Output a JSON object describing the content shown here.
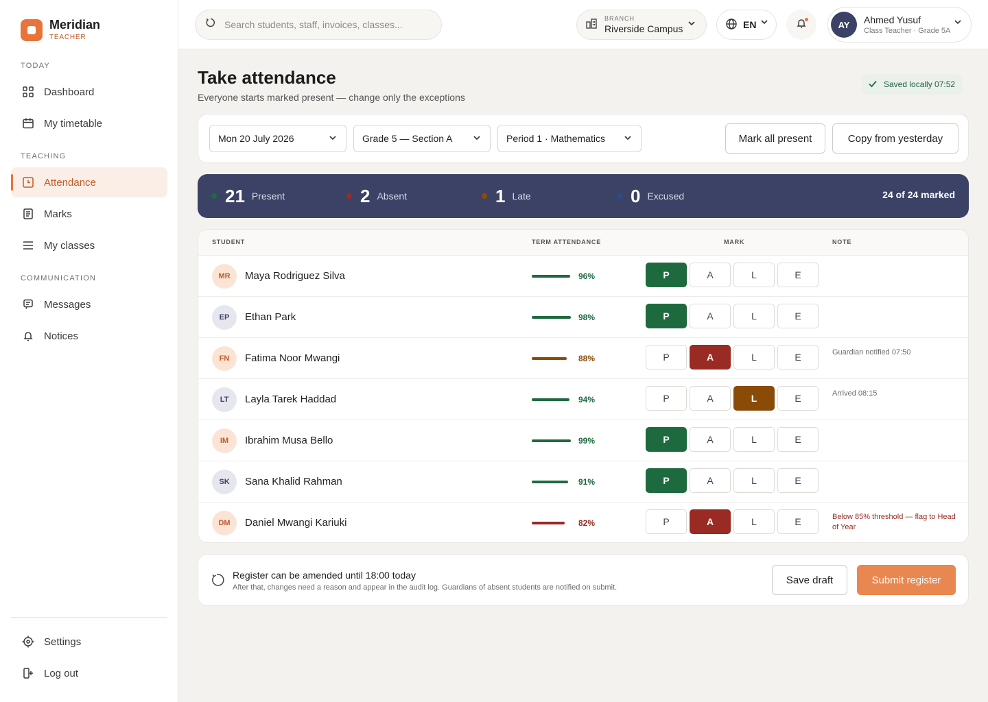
{
  "brand": {
    "name": "Meridian",
    "role": "TEACHER"
  },
  "sidebar": {
    "sections": {
      "today": "TODAY",
      "teaching": "TEACHING",
      "communication": "COMMUNICATION"
    },
    "items": [
      {
        "label": "Dashboard",
        "icon": "grid-icon"
      },
      {
        "label": "My timetable",
        "icon": "calendar-icon"
      },
      {
        "label": "Attendance",
        "icon": "attendance-icon",
        "active": true
      },
      {
        "label": "Marks",
        "icon": "document-icon"
      },
      {
        "label": "My classes",
        "icon": "list-icon"
      },
      {
        "label": "Messages",
        "icon": "message-icon"
      },
      {
        "label": "Notices",
        "icon": "bell-icon"
      },
      {
        "label": "Settings",
        "icon": "settings-icon"
      },
      {
        "label": "Log out",
        "icon": "logout-icon"
      }
    ]
  },
  "topbar": {
    "search_placeholder": "Search students, staff, invoices, classes...",
    "branch_label": "BRANCH",
    "branch_value": "Riverside Campus",
    "language": "EN",
    "user": {
      "initials": "AY",
      "name": "Ahmed Yusuf",
      "role": "Class Teacher · Grade 5A"
    }
  },
  "page": {
    "title": "Take attendance",
    "subtitle": "Everyone starts marked present — change only the exceptions",
    "saved": "Saved locally 07:52"
  },
  "filters": {
    "date": "Mon 20 July 2026",
    "class": "Grade 5 — Section A",
    "period": "Period 1 · Mathematics",
    "mark_all": "Mark all present",
    "copy": "Copy from yesterday"
  },
  "summary": {
    "stats": [
      {
        "count": "21",
        "label": "Present",
        "color": "#1e6a3f"
      },
      {
        "count": "2",
        "label": "Absent",
        "color": "#9a2a24"
      },
      {
        "count": "1",
        "label": "Late",
        "color": "#8a4b08"
      },
      {
        "count": "0",
        "label": "Excused",
        "color": "#2a4c8a"
      }
    ],
    "marked": "24 of 24 marked"
  },
  "table": {
    "headers": {
      "student": "STUDENT",
      "term": "TERM ATTENDANCE",
      "mark": "MARK",
      "note": "NOTE"
    },
    "mark_labels": [
      "P",
      "A",
      "L",
      "E"
    ],
    "rows": [
      {
        "initials": "MR",
        "name": "Maya Rodriguez Silva",
        "attendance": 96,
        "pct": "96%",
        "level": "good",
        "mark": "P",
        "note": ""
      },
      {
        "initials": "EP",
        "name": "Ethan Park",
        "attendance": 98,
        "pct": "98%",
        "level": "good",
        "mark": "P",
        "note": ""
      },
      {
        "initials": "FN",
        "name": "Fatima Noor Mwangi",
        "attendance": 88,
        "pct": "88%",
        "level": "mid",
        "mark": "A",
        "note": "Guardian notified 07:50"
      },
      {
        "initials": "LT",
        "name": "Layla Tarek Haddad",
        "attendance": 94,
        "pct": "94%",
        "level": "good",
        "mark": "L",
        "note": "Arrived 08:15"
      },
      {
        "initials": "IM",
        "name": "Ibrahim Musa Bello",
        "attendance": 99,
        "pct": "99%",
        "level": "good",
        "mark": "P",
        "note": ""
      },
      {
        "initials": "SK",
        "name": "Sana Khalid Rahman",
        "attendance": 91,
        "pct": "91%",
        "level": "good",
        "mark": "P",
        "note": ""
      },
      {
        "initials": "DM",
        "name": "Daniel Mwangi Kariuki",
        "attendance": 82,
        "pct": "82%",
        "level": "low",
        "mark": "A",
        "note": "Below 85% threshold — flag to Head of Year"
      }
    ]
  },
  "footer": {
    "title": "Register can be amended until 18:00 today",
    "desc": "After that, changes need a reason and appear in the audit log. Guardians of absent students are notified on submit.",
    "save": "Save draft",
    "submit": "Submit register"
  },
  "colors": {
    "accent": "#e8743b",
    "navy": "#3b4266",
    "good": "#1e6a3f",
    "mid": "#8a4b08",
    "low": "#9a2a24"
  }
}
